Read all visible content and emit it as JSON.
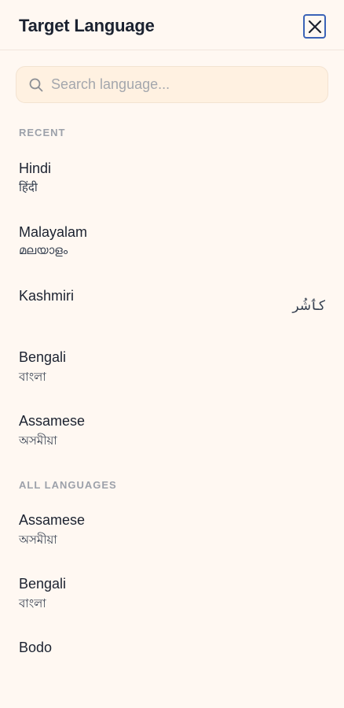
{
  "header": {
    "title": "Target Language",
    "close_icon": "close-icon"
  },
  "search": {
    "placeholder": "Search language...",
    "value": "",
    "icon": "search-icon"
  },
  "recent": {
    "label": "RECENT",
    "items": [
      {
        "name": "Hindi",
        "native": "हिंदी"
      },
      {
        "name": "Malayalam",
        "native": "മലയാളം"
      },
      {
        "name": "Kashmiri",
        "native": "كٲشُر"
      },
      {
        "name": "Bengali",
        "native": "বাংলা"
      },
      {
        "name": "Assamese",
        "native": "অসমীয়া"
      }
    ]
  },
  "all": {
    "label": "ALL LANGUAGES",
    "items": [
      {
        "name": "Assamese",
        "native": "অসমীয়া"
      },
      {
        "name": "Bengali",
        "native": "বাংলা"
      },
      {
        "name": "Bodo",
        "native": ""
      }
    ]
  },
  "colors": {
    "background": "#fff8f2",
    "accent": "#3b63b7",
    "search_bg": "#fff1e1"
  }
}
